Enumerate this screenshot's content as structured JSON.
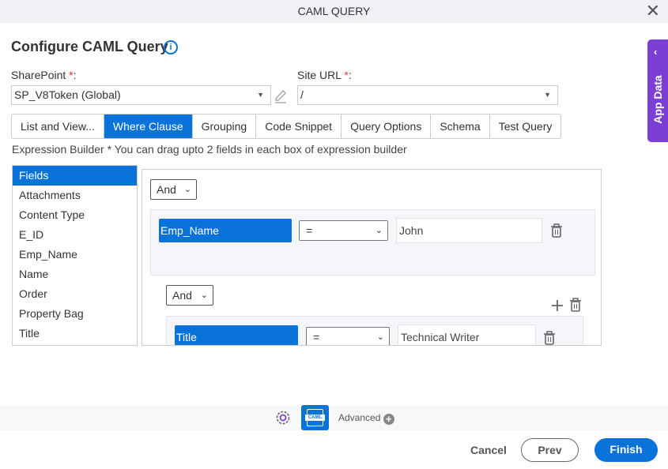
{
  "dialog": {
    "title": "CAML QUERY",
    "close_icon": "close-icon"
  },
  "header": {
    "title": "Configure CAML Query",
    "info_icon": "info-icon"
  },
  "sharepoint": {
    "label": "SharePoint",
    "required": "*",
    ":": ":",
    "value": "SP_V8Token (Global)"
  },
  "site_url": {
    "label": "Site URL",
    "required": "*",
    "value": "/"
  },
  "colon": ":",
  "tabs": [
    {
      "label": "List and View..."
    },
    {
      "label": "Where Clause",
      "active": true
    },
    {
      "label": "Grouping"
    },
    {
      "label": "Code Snippet"
    },
    {
      "label": "Query Options"
    },
    {
      "label": "Schema"
    },
    {
      "label": "Test Query"
    }
  ],
  "hint": "Expression Builder * You can drag upto 2 fields in each box of expression builder",
  "fields": [
    "Fields",
    "Attachments",
    "Content Type",
    "E_ID",
    "Emp_Name",
    "Name",
    "Order",
    "Property Bag",
    "Title"
  ],
  "builder": {
    "outer_operator": "And",
    "condition1": {
      "field": "Emp_Name",
      "operator": "=",
      "value": "John"
    },
    "inner_operator": "And",
    "condition2": {
      "field": "Title",
      "operator": "=",
      "value": "Technical Writer"
    }
  },
  "footer": {
    "advanced": "Advanced",
    "cancel": "Cancel",
    "prev": "Prev",
    "finish": "Finish",
    "caml_icon_text": "CAML"
  },
  "app_data": {
    "label": "App Data"
  },
  "colors": {
    "accent": "#0a73d9",
    "app_data": "#7b3fd6",
    "required": "#d9342b"
  }
}
